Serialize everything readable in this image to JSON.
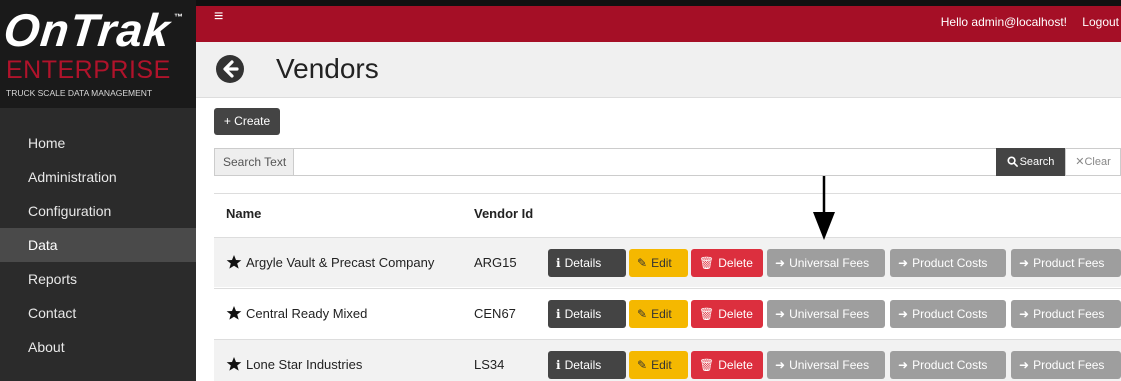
{
  "brand": {
    "name": "OnTrak",
    "tm": "™",
    "sub": "ENTERPRISE",
    "tagline": "TRUCK SCALE DATA MANAGEMENT"
  },
  "nav": {
    "items": [
      {
        "label": "Home"
      },
      {
        "label": "Administration"
      },
      {
        "label": "Configuration"
      },
      {
        "label": "Data"
      },
      {
        "label": "Reports"
      },
      {
        "label": "Contact"
      },
      {
        "label": "About"
      }
    ],
    "active": "Data"
  },
  "topbar": {
    "greeting": "Hello admin@localhost!",
    "logout": "Logout",
    "menu_icon": "hamburger-icon"
  },
  "page": {
    "title": "Vendors"
  },
  "toolbar": {
    "create_label": "+ Create"
  },
  "search": {
    "label": "Search Text",
    "value": "",
    "search_label": "Search",
    "clear_label": "Clear"
  },
  "table": {
    "columns": [
      "Name",
      "Vendor Id"
    ],
    "rows": [
      {
        "name": "Argyle Vault & Precast Company",
        "vendor_id": "ARG15"
      },
      {
        "name": "Central Ready Mixed",
        "vendor_id": "CEN67"
      },
      {
        "name": "Lone Star Industries",
        "vendor_id": "LS34"
      }
    ],
    "actions": {
      "details": "Details",
      "edit": "Edit",
      "delete": "Delete",
      "universal_fees": "Universal Fees",
      "product_costs": "Product Costs",
      "product_fees": "Product Fees"
    }
  },
  "colors": {
    "topbar": "#a50f26",
    "sidebar": "#2b2b2b",
    "edit": "#f5b800",
    "delete": "#dc2f3e",
    "secondary": "#9e9e9e"
  }
}
